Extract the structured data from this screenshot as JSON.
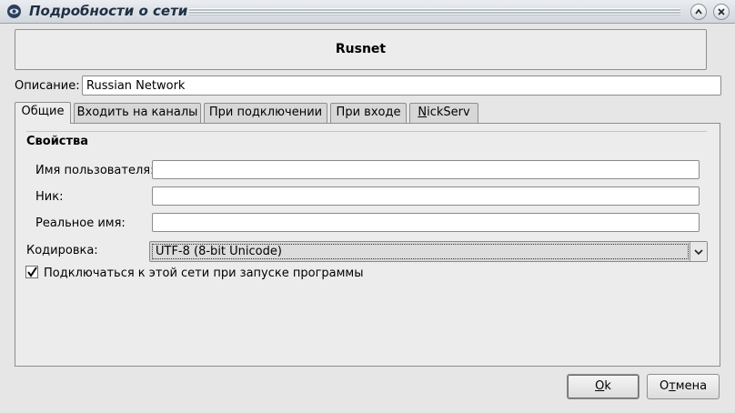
{
  "window": {
    "title": "Подробности о сети"
  },
  "network": {
    "name": "Rusnet"
  },
  "description": {
    "label": "Описание:",
    "value": "Russian Network"
  },
  "tabs": [
    {
      "label": "Общие",
      "active": true
    },
    {
      "label": "Входить на каналы",
      "active": false
    },
    {
      "label": "При подключении",
      "active": false
    },
    {
      "label": "При входе",
      "active": false
    },
    {
      "label": "NickServ",
      "active": false
    }
  ],
  "properties": {
    "heading": "Свойства",
    "username": {
      "label": "Имя пользователя:",
      "value": ""
    },
    "nick": {
      "label": "Ник:",
      "value": ""
    },
    "realname": {
      "label": "Реальное имя:",
      "value": ""
    }
  },
  "encoding": {
    "label": "Кодировка:",
    "value": "UTF-8 (8-bit Unicode)"
  },
  "autoconnect": {
    "label": "Подключаться к этой сети при запуске программы",
    "checked": true
  },
  "buttons": {
    "ok": "Ok",
    "cancel": "Отмена"
  }
}
